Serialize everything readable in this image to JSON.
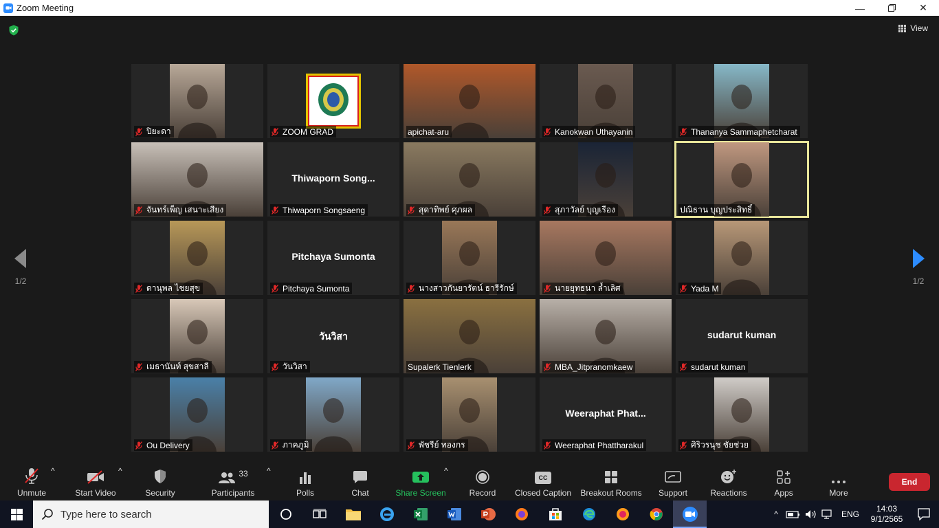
{
  "window": {
    "title": "Zoom Meeting"
  },
  "view": {
    "label": "View"
  },
  "pager": {
    "left_label": "1/2",
    "right_label": "1/2"
  },
  "participants": [
    {
      "name": "ปิยะดา",
      "muted": true,
      "video": "w80",
      "color": "#b8a898"
    },
    {
      "name": "ZOOM GRAD",
      "muted": true,
      "video": "logo",
      "color": "#ffffff"
    },
    {
      "name": "apichat-aru",
      "muted": false,
      "video": "full",
      "color": "#b0582a"
    },
    {
      "name": "Kanokwan Uthayanin",
      "muted": true,
      "video": "w80",
      "color": "#6a5a50"
    },
    {
      "name": "Thananya Sammaphetcharat",
      "muted": true,
      "video": "w80",
      "color": "#86b8c8"
    },
    {
      "name": "จันทร์เพ็ญ  เสนาะเสียง",
      "muted": true,
      "video": "full",
      "color": "#c8c0b8"
    },
    {
      "name": "Thiwaporn Songsaeng",
      "muted": true,
      "video": "none",
      "bigname": "Thiwaporn  Song..."
    },
    {
      "name": "สุดาทิพย์  ศุภผล",
      "muted": true,
      "video": "full",
      "color": "#8a7a60"
    },
    {
      "name": "สุภาวัลย์ บุญเรือง",
      "muted": true,
      "video": "w80",
      "color": "#1a2436"
    },
    {
      "name": "ปณิธาน บุญประสิทธิ์",
      "muted": false,
      "video": "w80",
      "color": "#c09880",
      "active": true
    },
    {
      "name": "ดานุพล ไชยสุข",
      "muted": true,
      "video": "w80",
      "color": "#b89858"
    },
    {
      "name": "Pitchaya Sumonta",
      "muted": true,
      "video": "none",
      "bigname": "Pitchaya Sumonta"
    },
    {
      "name": "นางสาวกันยารัตน์ ธารีรักษ์",
      "muted": true,
      "video": "w80",
      "color": "#9a7858"
    },
    {
      "name": "นายยุทธนา  ล้ำเลิศ",
      "muted": true,
      "video": "full",
      "color": "#a87860"
    },
    {
      "name": "Yada M",
      "muted": true,
      "video": "w80",
      "color": "#b89878"
    },
    {
      "name": "เมธานันท์ สุขสาลี",
      "muted": true,
      "video": "w80",
      "color": "#d8c8b8"
    },
    {
      "name": "วันวิสา",
      "muted": true,
      "video": "none",
      "bigname": "วันวิสา"
    },
    {
      "name": "Supalerk Tienlerk",
      "muted": false,
      "video": "full",
      "color": "#8a7040"
    },
    {
      "name": "MBA_Jitpranomkaew",
      "muted": true,
      "video": "full",
      "color": "#b8b0a8"
    },
    {
      "name": "sudarut kuman",
      "muted": true,
      "video": "none",
      "bigname": "sudarut kuman"
    },
    {
      "name": "Ou Delivery",
      "muted": true,
      "video": "w80",
      "color": "#4a80a8"
    },
    {
      "name": "ภาคภูมิ",
      "muted": true,
      "video": "w80",
      "color": "#80a8c8"
    },
    {
      "name": "พัชรีย์ ทองกร",
      "muted": true,
      "video": "w80",
      "color": "#a89070"
    },
    {
      "name": "Weeraphat Phattharakul",
      "muted": true,
      "video": "none",
      "bigname": "Weeraphat  Phat..."
    },
    {
      "name": "ศิริวรนุช ชัยช่วย",
      "muted": true,
      "video": "w80",
      "color": "#d0ccc8"
    }
  ],
  "toolbar": {
    "unmute": "Unmute",
    "start_video": "Start Video",
    "security": "Security",
    "participants": "Participants",
    "participants_count": "33",
    "polls": "Polls",
    "chat": "Chat",
    "share_screen": "Share Screen",
    "record": "Record",
    "closed_caption": "Closed Caption",
    "breakout_rooms": "Breakout Rooms",
    "support": "Support",
    "reactions": "Reactions",
    "apps": "Apps",
    "more": "More",
    "end": "End",
    "cc_badge": "CC"
  },
  "taskbar": {
    "search_placeholder": "Type here to search",
    "lang": "ENG",
    "time": "14:03",
    "date": "9/1/2565"
  },
  "colors": {
    "accent_green": "#25c05d",
    "end_red": "#c9262f",
    "active_speaker": "#e8e59a",
    "zoom_blue": "#2d8cff"
  }
}
